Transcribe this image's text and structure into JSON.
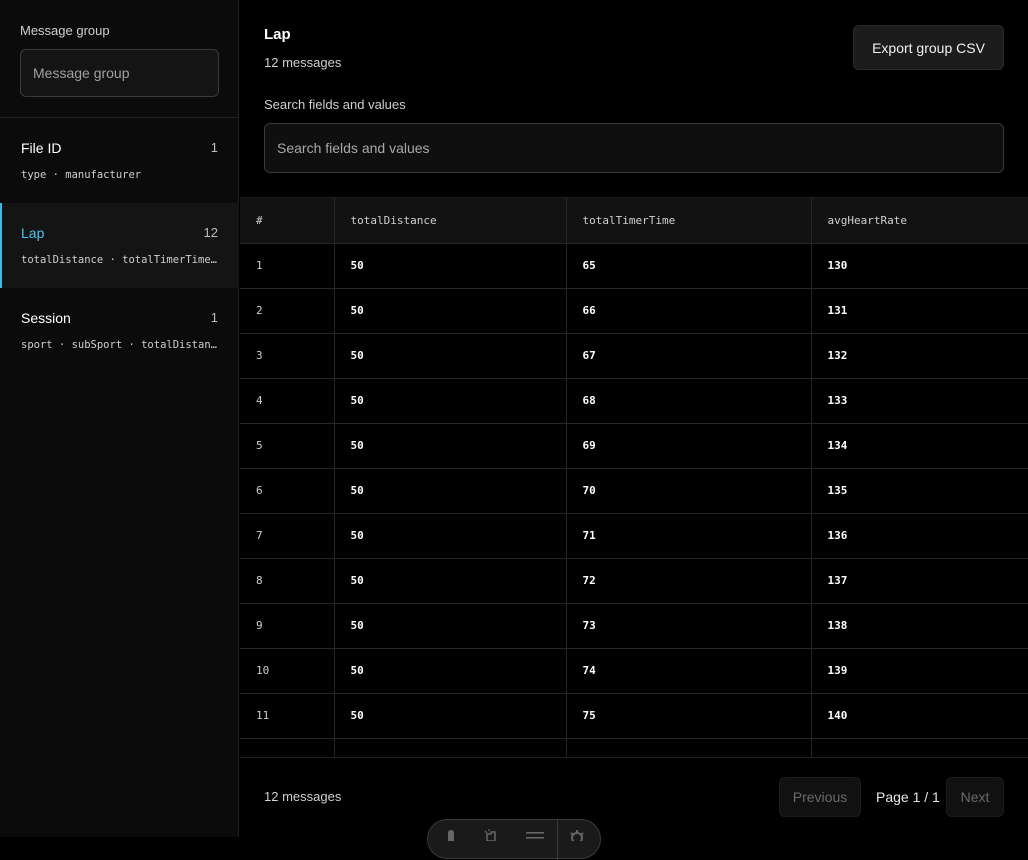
{
  "sidebar": {
    "filter_label": "Message group",
    "filter_placeholder": "Message group",
    "groups": [
      {
        "name": "File ID",
        "count": "1",
        "fields": "type · manufacturer"
      },
      {
        "name": "Lap",
        "count": "12",
        "fields": "totalDistance · totalTimerTime · avgHeartRate"
      },
      {
        "name": "Session",
        "count": "1",
        "fields": "sport · subSport · totalDistance · totalTimerTime"
      }
    ],
    "active_index": 1
  },
  "main": {
    "title": "Lap",
    "subtitle": "12 messages",
    "export_label": "Export group CSV",
    "search_label": "Search fields and values",
    "search_placeholder": "Search fields and values"
  },
  "table": {
    "columns": [
      "#",
      "totalDistance",
      "totalTimerTime",
      "avgHeartRate"
    ],
    "rows": [
      [
        "1",
        "50",
        "65",
        "130"
      ],
      [
        "2",
        "50",
        "66",
        "131"
      ],
      [
        "3",
        "50",
        "67",
        "132"
      ],
      [
        "4",
        "50",
        "68",
        "133"
      ],
      [
        "5",
        "50",
        "69",
        "134"
      ],
      [
        "6",
        "50",
        "70",
        "135"
      ],
      [
        "7",
        "50",
        "71",
        "136"
      ],
      [
        "8",
        "50",
        "72",
        "137"
      ],
      [
        "9",
        "50",
        "73",
        "138"
      ],
      [
        "10",
        "50",
        "74",
        "139"
      ],
      [
        "11",
        "50",
        "75",
        "140"
      ],
      [
        "",
        "",
        "",
        ""
      ]
    ]
  },
  "footer": {
    "count": "12 messages",
    "prev_label": "Previous",
    "page_indicator": "Page 1 / 1",
    "next_label": "Next"
  },
  "toolbar": {
    "icons": [
      "cursor-icon",
      "pointer-click-icon",
      "menu-icon",
      "gear-icon"
    ]
  },
  "colors": {
    "accent": "#4fc3ef",
    "background": "#000000",
    "sidebar_bg": "#0b0b0b"
  }
}
